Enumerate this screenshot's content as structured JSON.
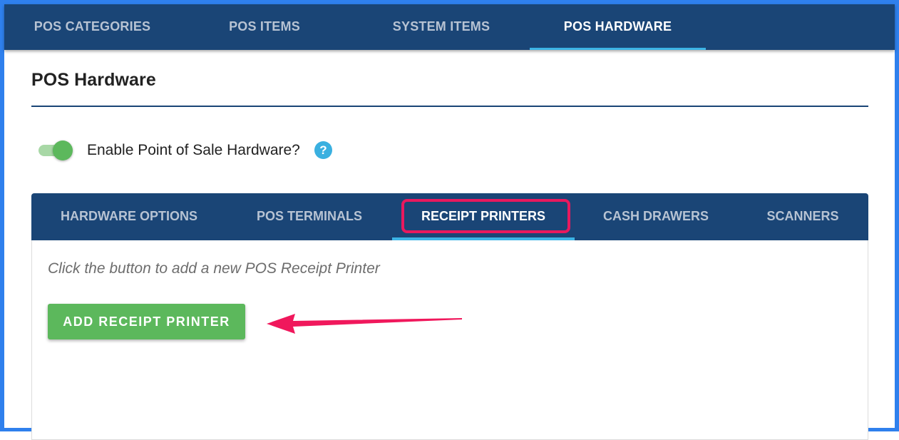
{
  "top_tabs": [
    {
      "label": "POS CATEGORIES"
    },
    {
      "label": "POS ITEMS"
    },
    {
      "label": "SYSTEM ITEMS"
    },
    {
      "label": "POS HARDWARE",
      "active": true
    }
  ],
  "page": {
    "title": "POS Hardware"
  },
  "toggle": {
    "label": "Enable Point of Sale Hardware?",
    "enabled": true,
    "help_icon": "?"
  },
  "hardware_tabs": [
    {
      "label": "HARDWARE OPTIONS"
    },
    {
      "label": "POS TERMINALS"
    },
    {
      "label": "RECEIPT PRINTERS",
      "active": true
    },
    {
      "label": "CASH DRAWERS"
    },
    {
      "label": "SCANNERS"
    }
  ],
  "panel": {
    "hint": "Click the button to add a new POS Receipt Printer",
    "add_button_label": "ADD RECEIPT PRINTER"
  },
  "colors": {
    "nav_bg": "#1a4576",
    "accent_underline": "#3cb4e5",
    "highlight": "#e8195e",
    "button_green": "#5cb85c",
    "frame_border": "#2f80ed"
  }
}
